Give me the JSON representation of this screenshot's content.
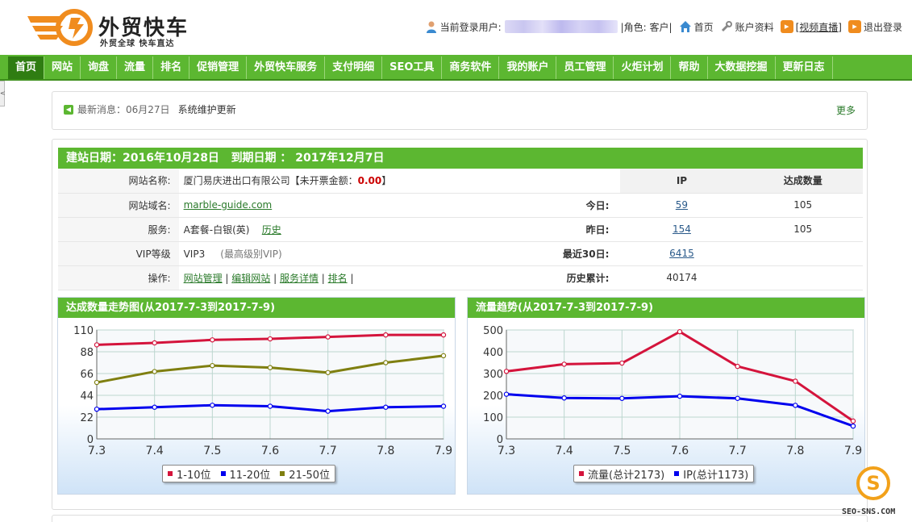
{
  "brand": {
    "title": "外贸快车",
    "subtitle": "外贸全球 快车直达",
    "accent": "#f08c1e",
    "green": "#5cb731"
  },
  "userbar": {
    "user_label": "当前登录用户:",
    "role": "|角色: 客户|",
    "home": "首页",
    "account": "账户资料",
    "video": "[视频直播]",
    "logout": "退出登录"
  },
  "nav": [
    "首页",
    "网站",
    "询盘",
    "流量",
    "排名",
    "促销管理",
    "外贸快车服务",
    "支付明细",
    "SEO工具",
    "商务软件",
    "我的账户",
    "员工管理",
    "火炬计划",
    "帮助",
    "大数据挖掘",
    "更新日志"
  ],
  "side_tab": "<",
  "notice": {
    "prefix": "最新消息：",
    "date": "06月27日",
    "title": "系统维护更新",
    "more": "更多"
  },
  "site": {
    "header_build": "建站日期：2016年10月28日",
    "header_expire": "到期日期 ： 2017年12月7日",
    "labels": [
      "网站名称:",
      "网站域名:",
      "服务:",
      "VIP等级",
      "操作:"
    ],
    "name": "厦门易庆进出口有限公司",
    "invoice_prefix": "【未开票金额：",
    "invoice_amount": "0.00",
    "invoice_suffix": "】",
    "domain": "marble-guide.com",
    "service": "A套餐-白银(英)",
    "history": "历史",
    "vip": "VIP3",
    "vip_note": "(最高级别VIP)",
    "ops": [
      "网站管理",
      "编辑网站",
      "服务详情",
      "排名"
    ],
    "stat_col_ip": "IP",
    "stat_col_ach": "达成数量",
    "stat_rows": [
      {
        "label": "今日:",
        "ip": "59",
        "ach": "105"
      },
      {
        "label": "昨日:",
        "ip": "154",
        "ach": "105"
      },
      {
        "label": "最近30日:",
        "ip": "6415",
        "ach": ""
      },
      {
        "label": "历史累计:",
        "ip": "40174",
        "ach": ""
      }
    ]
  },
  "chart_data": [
    {
      "type": "line",
      "title": "达成数量走势图(从2017-7-3到2017-7-9)",
      "x": [
        "7.3",
        "7.4",
        "7.5",
        "7.6",
        "7.7",
        "7.8",
        "7.9"
      ],
      "ylim": [
        0,
        110
      ],
      "yticks": [
        0,
        22,
        44,
        66,
        88,
        110
      ],
      "grid": true,
      "legend": "bottom-center",
      "series": [
        {
          "name": "1-10位",
          "color": "#d4143c",
          "values": [
            95,
            97,
            100,
            101,
            103,
            105,
            105
          ]
        },
        {
          "name": "11-20位",
          "color": "#0000ee",
          "values": [
            30,
            32,
            34,
            33,
            28,
            32,
            33
          ]
        },
        {
          "name": "21-50位",
          "color": "#7f7f10",
          "values": [
            57,
            68,
            74,
            72,
            67,
            77,
            84
          ]
        }
      ]
    },
    {
      "type": "line",
      "title": "流量趋势(从2017-7-3到2017-7-9)",
      "x": [
        "7.3",
        "7.4",
        "7.5",
        "7.6",
        "7.7",
        "7.8",
        "7.9"
      ],
      "ylim": [
        0,
        500
      ],
      "yticks": [
        0,
        100,
        200,
        300,
        400,
        500
      ],
      "grid": true,
      "legend": "bottom-center",
      "series": [
        {
          "name": "流量(总计2173)",
          "color": "#d4143c",
          "values": [
            310,
            343,
            348,
            492,
            333,
            265,
            82
          ]
        },
        {
          "name": "IP(总计1173)",
          "color": "#0000ee",
          "values": [
            205,
            188,
            186,
            196,
            186,
            154,
            59
          ]
        }
      ]
    }
  ],
  "watermark": {
    "text": "SEO-SNS.COM",
    "glyph": "S"
  }
}
